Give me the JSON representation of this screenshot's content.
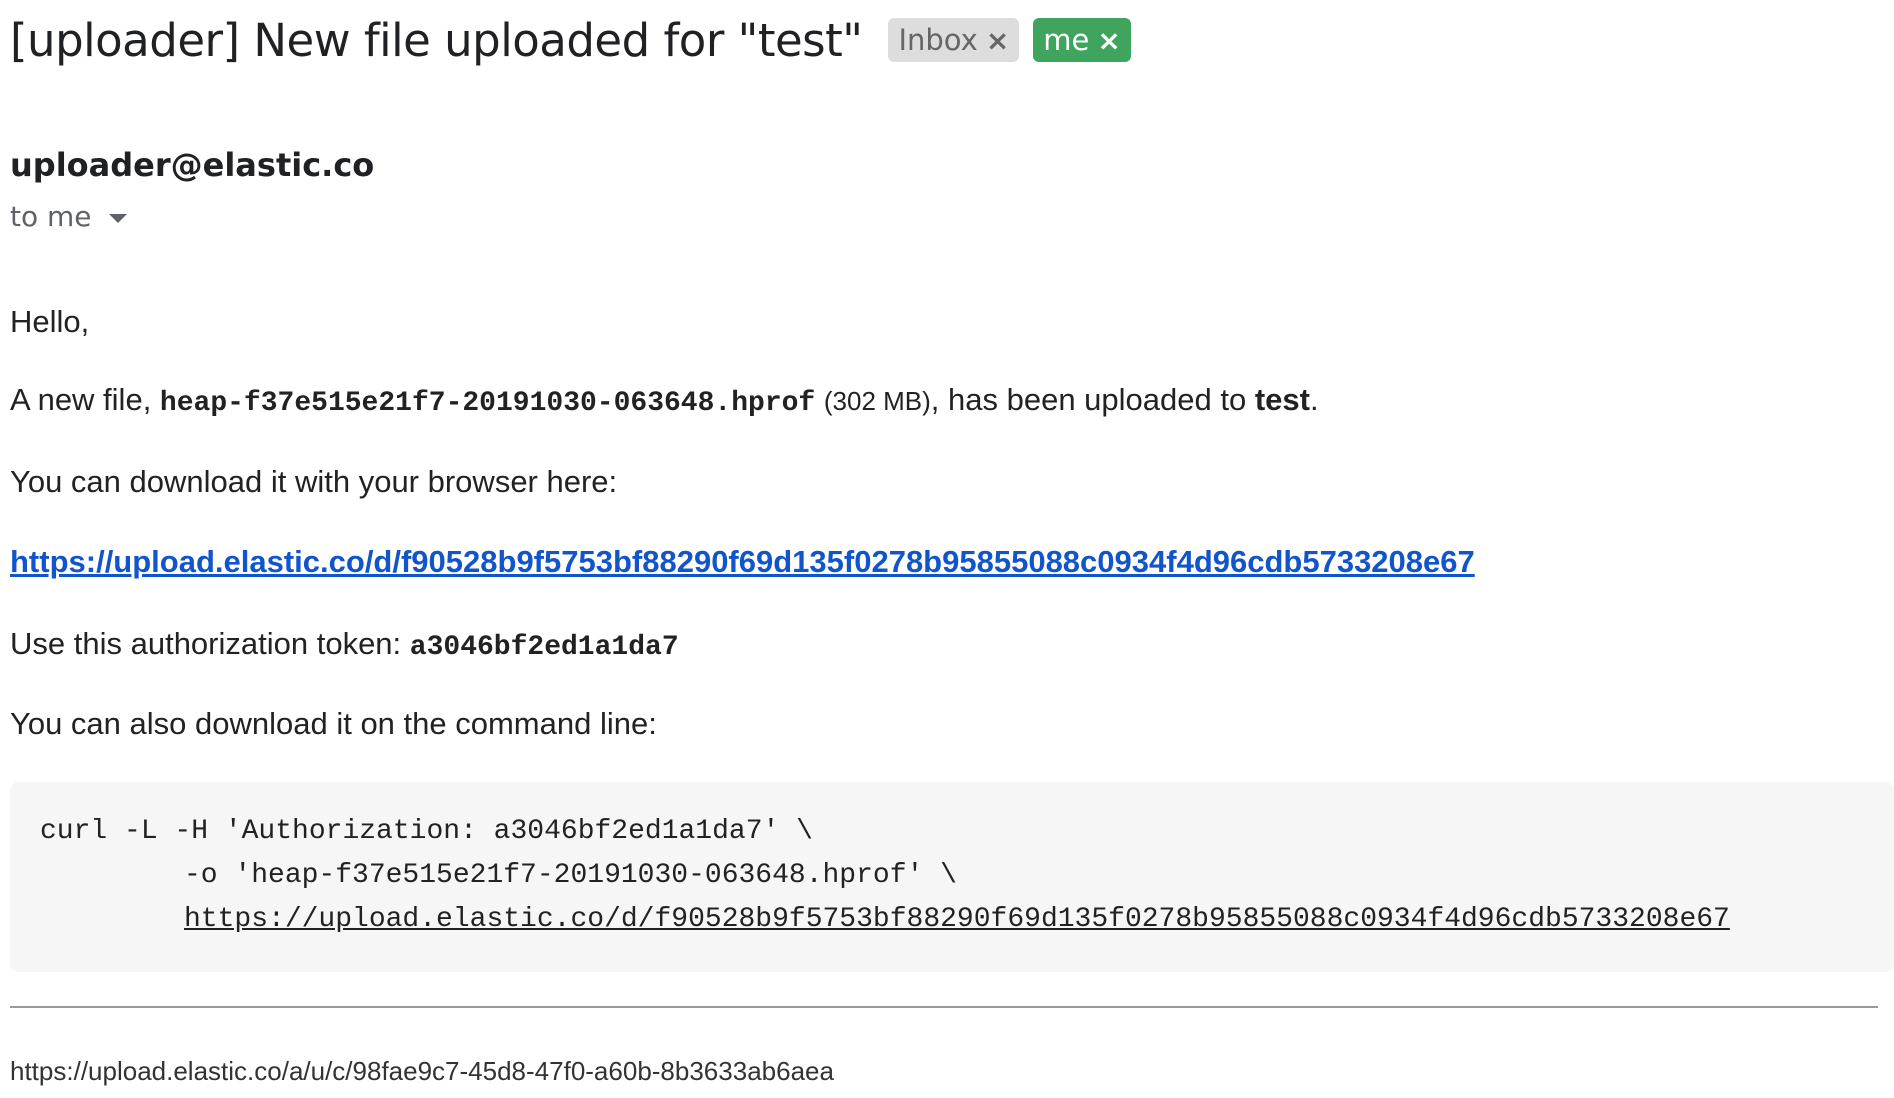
{
  "email": {
    "subject": "[uploader] New file uploaded for \"test\"",
    "labels": [
      {
        "text": "Inbox",
        "close": "×"
      },
      {
        "text": "me",
        "close": "×"
      }
    ],
    "sender": "uploader@elastic.co",
    "recipient": "to me",
    "recipient_dropdown_icon": "caret-down-icon",
    "label_colors": {
      "inbox_bg": "#dddddd",
      "me_bg": "#3fa45e",
      "link": "#1155cc"
    }
  },
  "body": {
    "greeting": "Hello,",
    "new_file_prefix": "A new file, ",
    "filename": "heap-f37e515e21f7-20191030-063648.hprof",
    "file_size": "(302 MB)",
    "uploaded_to_text": ", has been uploaded to ",
    "target": "test",
    "period": ".",
    "browser_text": "You can download it with your browser here:",
    "download_url": "https://upload.elastic.co/d/f90528b9f5753bf88290f69d135f0278b95855088c0934f4d96cdb5733208e67",
    "token_prefix": "Use this authorization token: ",
    "token": "a3046bf2ed1a1da7",
    "cli_text": "You can also download it on the command line:"
  },
  "code": {
    "line1": "curl -L -H 'Authorization: a3046bf2ed1a1da7' \\",
    "line2": "-o 'heap-f37e515e21f7-20191030-063648.hprof' \\",
    "line3": "https://upload.elastic.co/d/f90528b9f5753bf88290f69d135f0278b95855088c0934f4d96cdb5733208e67"
  },
  "footer": {
    "unsubscribe_url": "https://upload.elastic.co/a/u/c/98fae9c7-45d8-47f0-a60b-8b3633ab6aea"
  }
}
